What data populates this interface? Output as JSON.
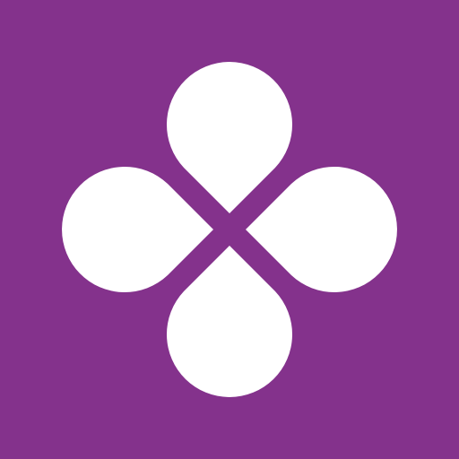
{
  "icon": {
    "name": "four-petal-flower-logo",
    "background_color": "#84328C",
    "petal_color": "#FFFFFF",
    "petal_count": 4
  }
}
